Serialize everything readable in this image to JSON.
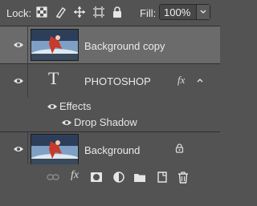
{
  "lockbar": {
    "lock_label": "Lock:",
    "lock_icons": [
      "lock-transparent-pixels-icon",
      "lock-image-pixels-icon",
      "lock-position-icon",
      "lock-artboard-icon",
      "lock-all-icon"
    ],
    "fill_label": "Fill:",
    "fill_value": "100%"
  },
  "layers": [
    {
      "name": "Background copy",
      "type": "image",
      "visible": true,
      "selected": true
    },
    {
      "name": "PHOTOSHOP",
      "type": "text",
      "visible": true,
      "selected": false,
      "has_effects": true,
      "effects_label": "Effects",
      "effects": [
        "Drop Shadow"
      ]
    },
    {
      "name": "Background",
      "type": "image",
      "visible": true,
      "selected": false,
      "locked": true
    }
  ],
  "bottombar": {
    "icons": [
      "link-layers-icon",
      "fx-icon",
      "layer-mask-icon",
      "adjustment-layer-icon",
      "new-group-icon",
      "new-layer-icon",
      "delete-layer-icon"
    ],
    "fx_label": "fx"
  },
  "colors": {
    "panel": "#535353",
    "selected_row": "#6b6b6b"
  }
}
